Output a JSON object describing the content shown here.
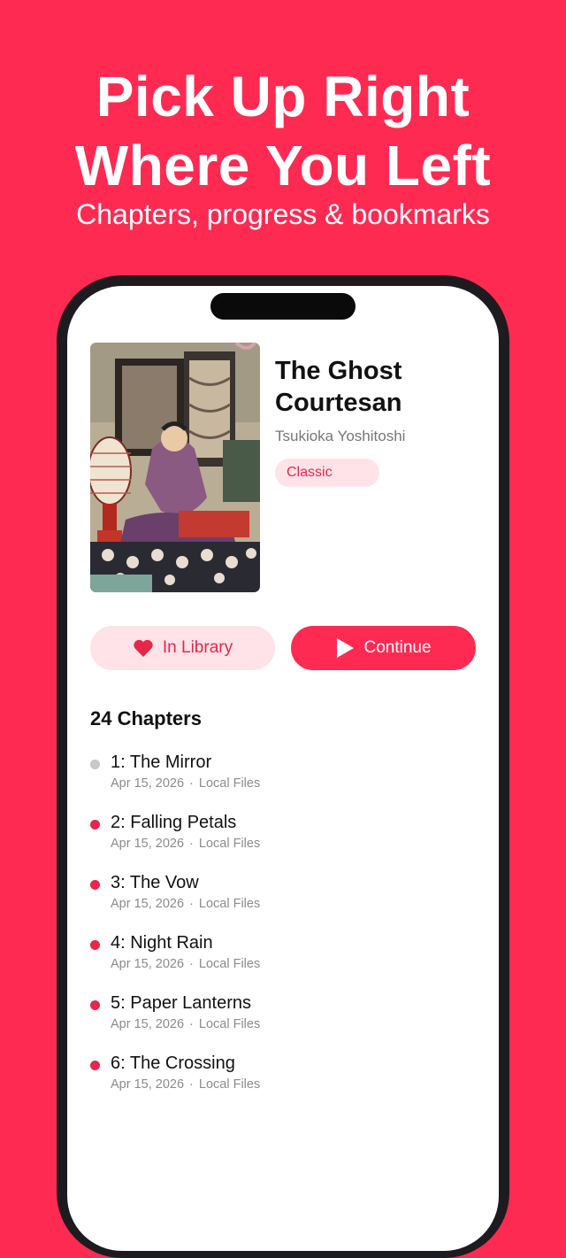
{
  "promo": {
    "headline_line1": "Pick Up Right",
    "headline_line2": "Where You Left",
    "subheadline": "Chapters, progress & bookmarks"
  },
  "book": {
    "title_line1": "The Ghost",
    "title_line2": "Courtesan",
    "author": "Tsukioka Yoshitoshi",
    "genre": "Classic"
  },
  "actions": {
    "library_label": "In Library",
    "library_icon": "heart-icon",
    "continue_label": "Continue",
    "continue_icon": "play-icon"
  },
  "chapters": {
    "heading": "24 Chapters",
    "items": [
      {
        "title": "1: The Mirror",
        "date": "Apr 15, 2026",
        "source": "Local Files",
        "separator": "·",
        "unread": false
      },
      {
        "title": "2: Falling Petals",
        "date": "Apr 15, 2026",
        "source": "Local Files",
        "separator": "·",
        "unread": true
      },
      {
        "title": "3: The Vow",
        "date": "Apr 15, 2026",
        "source": "Local Files",
        "separator": "·",
        "unread": true
      },
      {
        "title": "4: Night Rain",
        "date": "Apr 15, 2026",
        "source": "Local Files",
        "separator": "·",
        "unread": true
      },
      {
        "title": "5: Paper Lanterns",
        "date": "Apr 15, 2026",
        "source": "Local Files",
        "separator": "·",
        "unread": true
      },
      {
        "title": "6: The Crossing",
        "date": "Apr 15, 2026",
        "source": "Local Files",
        "separator": "·",
        "unread": true
      }
    ]
  },
  "colors": {
    "accent": "#FF2A52",
    "accent_soft": "#FFE3E8",
    "read_dot": "#C7C7CC",
    "unread_dot": "#E8264A"
  }
}
